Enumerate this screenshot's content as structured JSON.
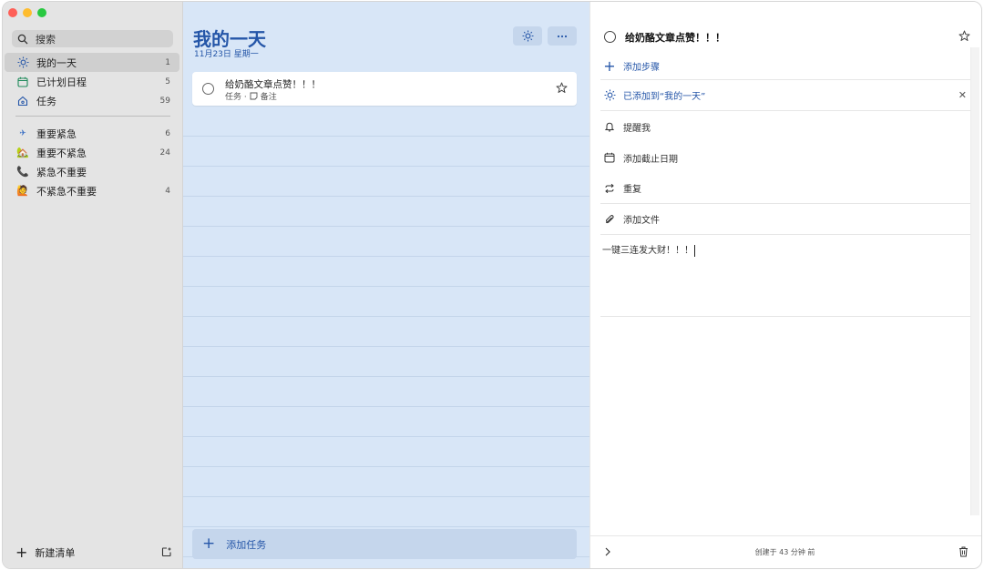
{
  "sidebar": {
    "search_label": "搜索",
    "items": [
      {
        "label": "我的一天",
        "count": "1",
        "icon": "sun-icon"
      },
      {
        "label": "已计划日程",
        "count": "5",
        "icon": "calendar-icon"
      },
      {
        "label": "任务",
        "count": "59",
        "icon": "home-icon"
      }
    ],
    "lists": [
      {
        "label": "重要紧急",
        "count": "6",
        "icon": "✈"
      },
      {
        "label": "重要不紧急",
        "count": "24",
        "icon": "🏡"
      },
      {
        "label": "紧急不重要",
        "count": "",
        "icon": "📞"
      },
      {
        "label": "不紧急不重要",
        "count": "4",
        "icon": "🙋"
      }
    ],
    "new_list_label": "新建清单"
  },
  "main": {
    "title": "我的一天",
    "date": "11月23日 星期一",
    "task": {
      "title": "给奶酪文章点赞！！！",
      "list": "任务 ·",
      "note_label": "备注"
    },
    "add_task_label": "添加任务"
  },
  "detail": {
    "task_title": "给奶酪文章点赞！！！",
    "add_step_label": "添加步骤",
    "added_to_my_day": "已添加到“我的一天”",
    "remind_label": "提醒我",
    "due_label": "添加截止日期",
    "repeat_label": "重复",
    "add_file_label": "添加文件",
    "note": "一键三连发大财！！！",
    "created": "创建于 43 分钟 前"
  },
  "colors": {
    "accent": "#2556a8",
    "sidebar_bg": "#e4e4e4",
    "main_bg": "#d8e6f7"
  }
}
